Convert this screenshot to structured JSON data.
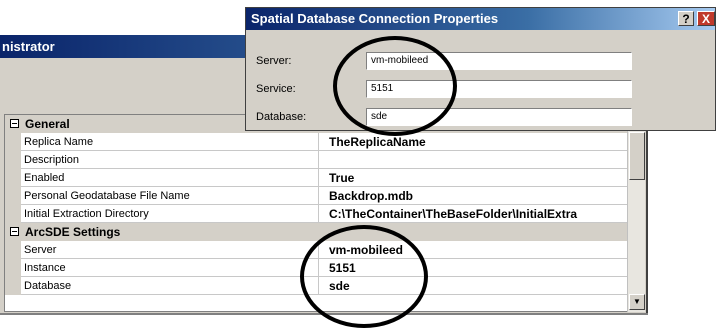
{
  "admin_window": {
    "title": "nistrator",
    "categories": [
      {
        "label": "General",
        "properties": [
          {
            "name": "Replica Name",
            "value": "TheReplicaName"
          },
          {
            "name": "Description",
            "value": ""
          },
          {
            "name": "Enabled",
            "value": "True"
          },
          {
            "name": "Personal Geodatabase File Name",
            "value": "Backdrop.mdb"
          },
          {
            "name": "Initial Extraction Directory",
            "value": "C:\\TheContainer\\TheBaseFolder\\InitialExtra"
          }
        ]
      },
      {
        "label": "ArcSDE Settings",
        "properties": [
          {
            "name": "Server",
            "value": "vm-mobileed"
          },
          {
            "name": "Instance",
            "value": "5151"
          },
          {
            "name": "Database",
            "value": "sde"
          }
        ]
      }
    ]
  },
  "dialog": {
    "title": "Spatial Database Connection Properties",
    "help_label": "?",
    "close_label": "X",
    "fields": [
      {
        "label": "Server:",
        "value": "vm-mobileed"
      },
      {
        "label": "Service:",
        "value": "5151"
      },
      {
        "label": "Database:",
        "value": "sde"
      }
    ]
  },
  "icons": {
    "collapse": "collapse-minus-icon",
    "scroll_down": "scroll-down-arrow-icon"
  },
  "colors": {
    "titlebar_start": "#0a246a",
    "titlebar_end": "#a6caf0",
    "window_face": "#d4d0c8",
    "close_button": "#c0392b"
  }
}
